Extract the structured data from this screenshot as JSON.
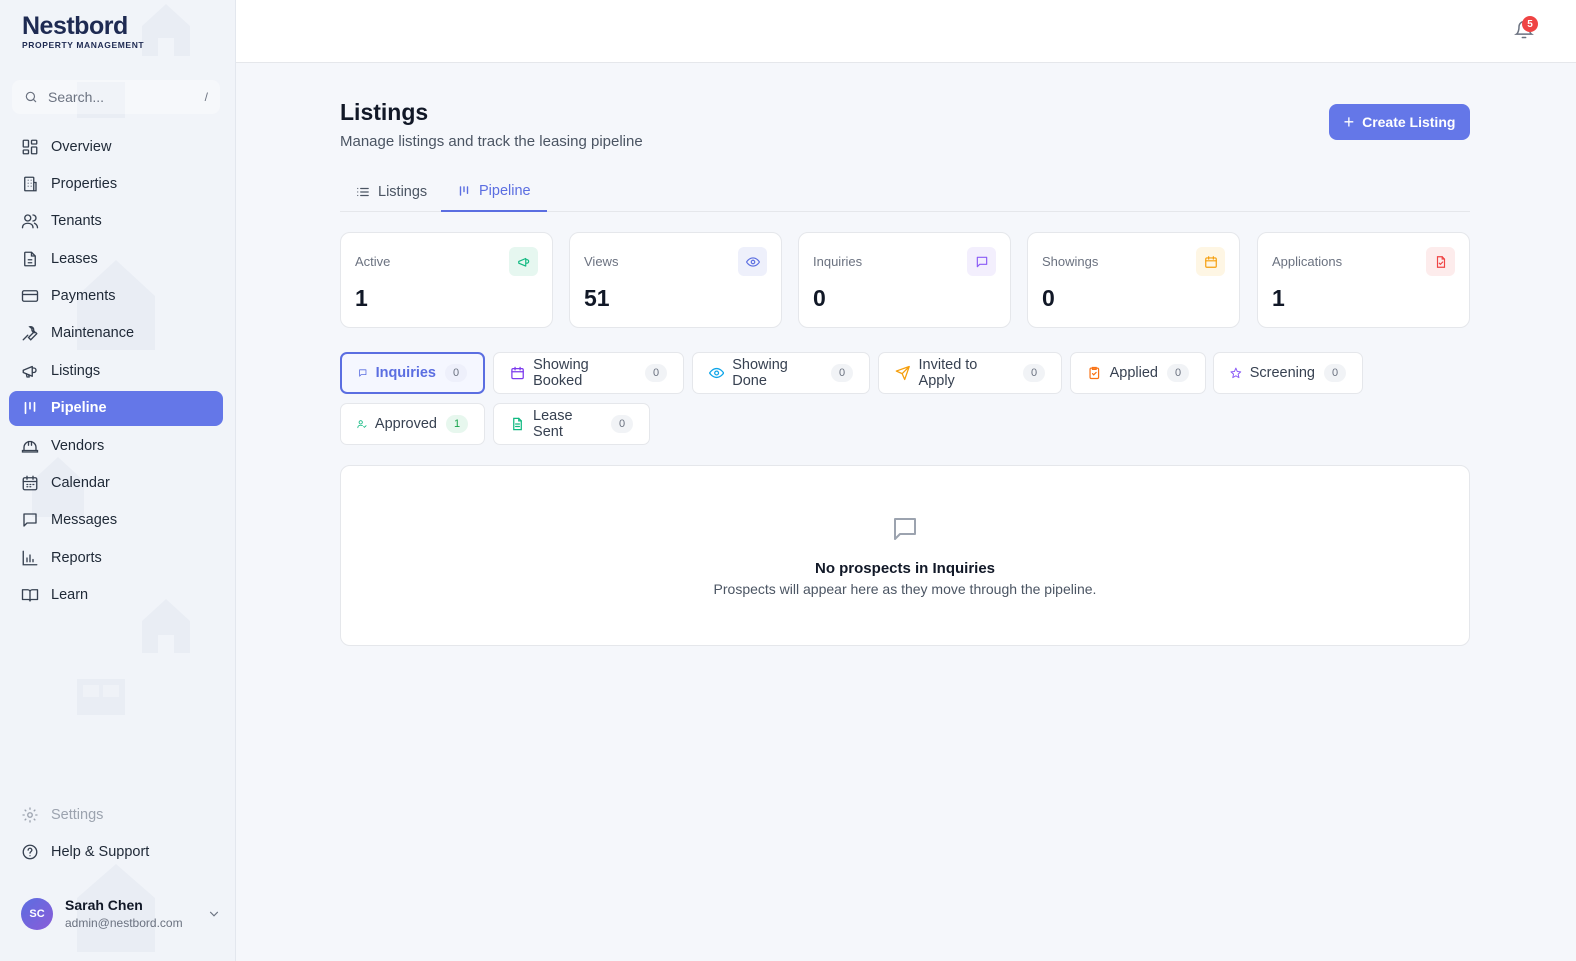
{
  "brand": {
    "name": "Nestbord",
    "tagline": "PROPERTY MANAGEMENT"
  },
  "search": {
    "placeholder": "Search...",
    "shortcut": "/"
  },
  "sidebar": {
    "items": [
      {
        "label": "Overview",
        "icon": "grid-icon"
      },
      {
        "label": "Properties",
        "icon": "building-icon"
      },
      {
        "label": "Tenants",
        "icon": "users-icon"
      },
      {
        "label": "Leases",
        "icon": "document-icon"
      },
      {
        "label": "Payments",
        "icon": "credit-card-icon"
      },
      {
        "label": "Maintenance",
        "icon": "wrench-icon"
      },
      {
        "label": "Listings",
        "icon": "megaphone-icon"
      },
      {
        "label": "Pipeline",
        "icon": "kanban-icon",
        "active": true
      },
      {
        "label": "Vendors",
        "icon": "hard-hat-icon"
      },
      {
        "label": "Calendar",
        "icon": "calendar-icon"
      },
      {
        "label": "Messages",
        "icon": "message-icon"
      },
      {
        "label": "Reports",
        "icon": "bar-chart-icon"
      },
      {
        "label": "Learn",
        "icon": "book-icon"
      }
    ],
    "settings_label": "Settings",
    "help_label": "Help & Support"
  },
  "user": {
    "initials": "SC",
    "name": "Sarah Chen",
    "email": "admin@nestbord.com"
  },
  "notifications": {
    "count": "5"
  },
  "page": {
    "title": "Listings",
    "subtitle": "Manage listings and track the leasing pipeline",
    "create_label": "Create Listing",
    "tabs": [
      {
        "label": "Listings",
        "icon": "list-icon"
      },
      {
        "label": "Pipeline",
        "icon": "kanban-icon",
        "active": true
      }
    ]
  },
  "stats": [
    {
      "label": "Active",
      "value": "1",
      "icon": "megaphone-icon",
      "color": "#10b981",
      "bg": "#e6f7f0"
    },
    {
      "label": "Views",
      "value": "51",
      "icon": "eye-icon",
      "color": "#5b6ee1",
      "bg": "#eef0fb"
    },
    {
      "label": "Inquiries",
      "value": "0",
      "icon": "message-icon",
      "color": "#8b5cf6",
      "bg": "#f3effd"
    },
    {
      "label": "Showings",
      "value": "0",
      "icon": "calendar-icon",
      "color": "#f59e0b",
      "bg": "#fef6e4"
    },
    {
      "label": "Applications",
      "value": "1",
      "icon": "file-icon",
      "color": "#ef4444",
      "bg": "#fdecec"
    }
  ],
  "stages": [
    {
      "label": "Inquiries",
      "count": "0",
      "icon": "message-icon",
      "color": "#5b6ee1",
      "active": true
    },
    {
      "label": "Showing Booked",
      "count": "0",
      "icon": "calendar-icon",
      "color": "#7c3aed"
    },
    {
      "label": "Showing Done",
      "count": "0",
      "icon": "eye-icon",
      "color": "#0ea5e9"
    },
    {
      "label": "Invited to Apply",
      "count": "0",
      "icon": "send-icon",
      "color": "#f59e0b"
    },
    {
      "label": "Applied",
      "count": "0",
      "icon": "clipboard-check-icon",
      "color": "#f97316"
    },
    {
      "label": "Screening",
      "count": "0",
      "icon": "star-icon",
      "color": "#8b5cf6"
    },
    {
      "label": "Approved",
      "count": "1",
      "icon": "user-check-icon",
      "color": "#10b981"
    },
    {
      "label": "Lease Sent",
      "count": "0",
      "icon": "file-text-icon",
      "color": "#10b981"
    }
  ],
  "empty": {
    "title": "No prospects in Inquiries",
    "subtitle": "Prospects will appear here as they move through the pipeline."
  }
}
